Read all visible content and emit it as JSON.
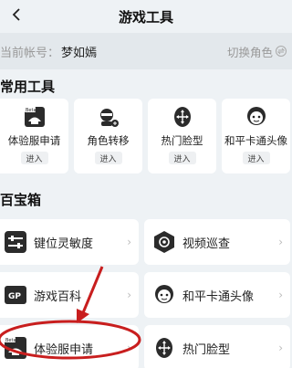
{
  "header": {
    "title": "游戏工具"
  },
  "account": {
    "prefix": "当前帐号：",
    "name": "梦如嫣",
    "switch_label": "切换角色"
  },
  "common_tools": {
    "title": "常用工具",
    "items": [
      {
        "label": "体验服申请",
        "enter": "进入",
        "icon": "beta-server-icon",
        "badge": "Beta"
      },
      {
        "label": "角色转移",
        "enter": "进入",
        "icon": "role-transfer-icon"
      },
      {
        "label": "热门脸型",
        "enter": "进入",
        "icon": "popular-face-icon"
      },
      {
        "label": "和平卡通头像",
        "enter": "进入",
        "icon": "cartoon-avatar-icon"
      }
    ]
  },
  "treasure_box": {
    "title": "百宝箱",
    "items": [
      {
        "label": "键位灵敏度",
        "icon": "sensitivity-icon"
      },
      {
        "label": "视频巡查",
        "icon": "video-patrol-icon"
      },
      {
        "label": "游戏百科",
        "icon": "game-wiki-icon",
        "badge": "GP"
      },
      {
        "label": "和平卡通头像",
        "icon": "cartoon-avatar-icon"
      },
      {
        "label": "体验服申请",
        "icon": "beta-server-icon",
        "badge": "Beta"
      },
      {
        "label": "热门脸型",
        "icon": "popular-face-icon"
      }
    ]
  },
  "colors": {
    "annotation": "#c81e1e",
    "background": "#eef2f5",
    "card": "#ffffff"
  }
}
